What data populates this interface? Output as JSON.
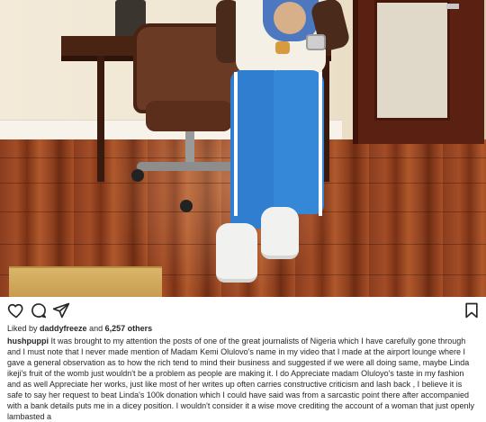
{
  "post": {
    "liked_by_prefix": "Liked by ",
    "liked_by_user": "daddyfreeze",
    "liked_by_and": " and ",
    "liked_by_others": "6,257 others",
    "caption_user": "hushpuppi",
    "caption_text": "It was brought to my attention the posts of one of the great journalists of Nigeria which I have carefully gone through and I must note that I never made mention of Madam Kemi Olulovo's name in my video that I made at the airport lounge where I gave a general observation as to how the rich tend to mind their business and suggested if we were all doing same, maybe Linda ikeji's fruit of the womb just  wouldn't be a problem as people are making it. I do Appreciate madam Oluloyo's taste in my fashion and as well Appreciate her works, just like most of her writes up often carries constructive criticism and lash back , I believe it is safe to say her request to beat Linda's 100k donation which I could have said was from a sarcastic point there after accompanied with a bank details puts me in a dicey position.  I wouldn't consider it a wise move crediting the account of a woman that just openly lambasted a"
  },
  "icons": {
    "like": "heart-icon",
    "comment": "comment-icon",
    "share": "send-icon",
    "save": "bookmark-icon"
  },
  "colors": {
    "text": "#262626",
    "icon": "#262626"
  }
}
